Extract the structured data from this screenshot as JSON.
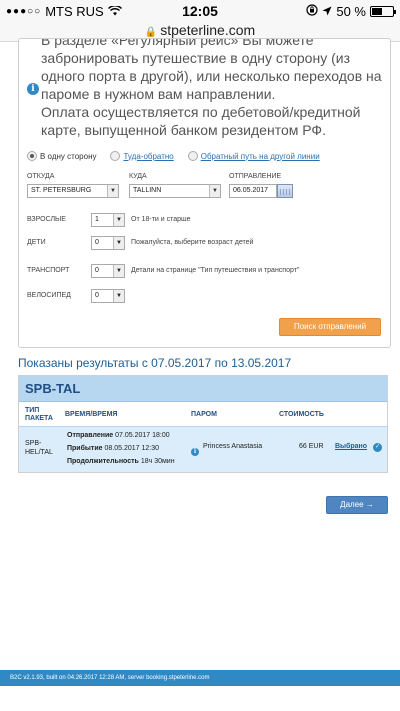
{
  "status_bar": {
    "carrier": "MTS RUS",
    "time": "12:05",
    "battery": "50 %",
    "battery_level": 0.5
  },
  "browser": {
    "url": "stpeterline.com"
  },
  "info": {
    "p1": "В разделе «Регулярный рейс» Вы можете забронировать путешествие в одну сторону (из одного порта в другой), или несколько переходов на пароме в нужном вам направлении.",
    "p2": "Оплата осуществляется по дебетовой/кредитной карте, выпущенной банком резидентом РФ."
  },
  "trip_type": {
    "one_way": "В одну сторону",
    "round_trip": "Туда-обратно",
    "other_line_return": "Обратный путь на другой линии"
  },
  "form": {
    "from_label": "ОТКУДА",
    "from_value": "ST. PETERSBURG",
    "to_label": "КУДА",
    "to_value": "TALLINN",
    "departure_label": "ОТПРАВЛЕНИЕ",
    "departure_value": "06.05.2017",
    "adults_label": "ВЗРОСЛЫЕ",
    "adults_value": "1",
    "adults_hint": "От 18-ти и старше",
    "children_label": "ДЕТИ",
    "children_value": "0",
    "children_hint": "Пожалуйста, выберите возраст детей",
    "transport_label": "ТРАНСПОРТ",
    "transport_value": "0",
    "transport_hint": "Детали на странице \"Тип путешествия и транспорт\"",
    "bicycle_label": "ВЕЛОСИПЕД",
    "bicycle_value": "0",
    "search_button": "Поиск отправлений"
  },
  "results": {
    "title": "Показаны результаты с 07.05.2017 по 13.05.2017",
    "route": "SPB-TAL",
    "headers": {
      "package_type": "ТИП ПАКЕТА",
      "time": "ВРЕМЯ/ВРЕМЯ",
      "ferry": "ПАРОМ",
      "price": "СТОИМОСТЬ"
    },
    "row": {
      "package": "SPB-HEL/TAL",
      "departure_label": "Отправление",
      "departure_value": "07.05.2017 18:00",
      "arrival_label": "Прибытие",
      "arrival_value": "08.05.2017 12:30",
      "duration_label": "Продолжительность",
      "duration_value": "18ч 30мин",
      "ferry": "Princess Anastasia",
      "price": "66 EUR",
      "selected": "Выбрано"
    },
    "next_button": "Далее →"
  },
  "footer": {
    "text": "B2C v2.1.93, built on 04.26.2017 12:28 AM, server booking.stpeterline.com"
  }
}
